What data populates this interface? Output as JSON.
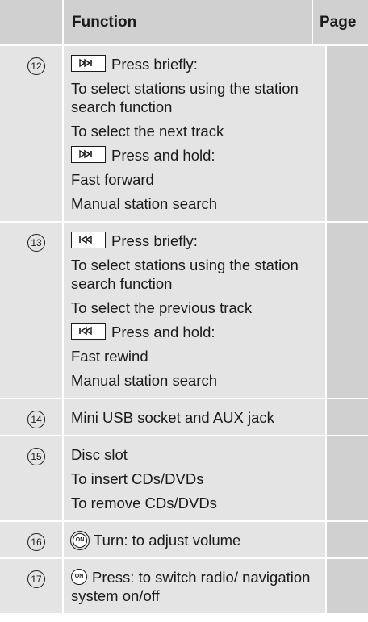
{
  "header": {
    "function": "Function",
    "page": "Page"
  },
  "rows": [
    {
      "num": "12",
      "lines": [
        {
          "icon": "next-track-key",
          "text": "Press briefly:"
        },
        {
          "text": "To select stations using the station search function"
        },
        {
          "text": "To select the next track"
        },
        {
          "icon": "next-track-key",
          "text": "Press and hold:"
        },
        {
          "text": "Fast forward"
        },
        {
          "text": "Manual station search"
        }
      ]
    },
    {
      "num": "13",
      "lines": [
        {
          "icon": "previous-track-key",
          "text": "Press briefly:"
        },
        {
          "text": "To select stations using the station search function"
        },
        {
          "text": "To select the previous track"
        },
        {
          "icon": "previous-track-key",
          "text": "Press and hold:"
        },
        {
          "text": "Fast rewind"
        },
        {
          "text": "Manual station search"
        }
      ]
    },
    {
      "num": "14",
      "lines": [
        {
          "text": "Mini USB socket and AUX jack"
        }
      ]
    },
    {
      "num": "15",
      "lines": [
        {
          "text": "Disc slot"
        },
        {
          "text": "To insert CDs/DVDs"
        },
        {
          "text": "To remove CDs/DVDs"
        }
      ]
    },
    {
      "num": "16",
      "lines": [
        {
          "icon": "volume-knob",
          "knob_label": "ON",
          "text": "Turn: to adjust volume"
        }
      ]
    },
    {
      "num": "17",
      "lines": [
        {
          "icon": "on-button",
          "knob_label": "ON",
          "text": "Press: to switch radio/ navigation system on/off"
        }
      ]
    }
  ]
}
